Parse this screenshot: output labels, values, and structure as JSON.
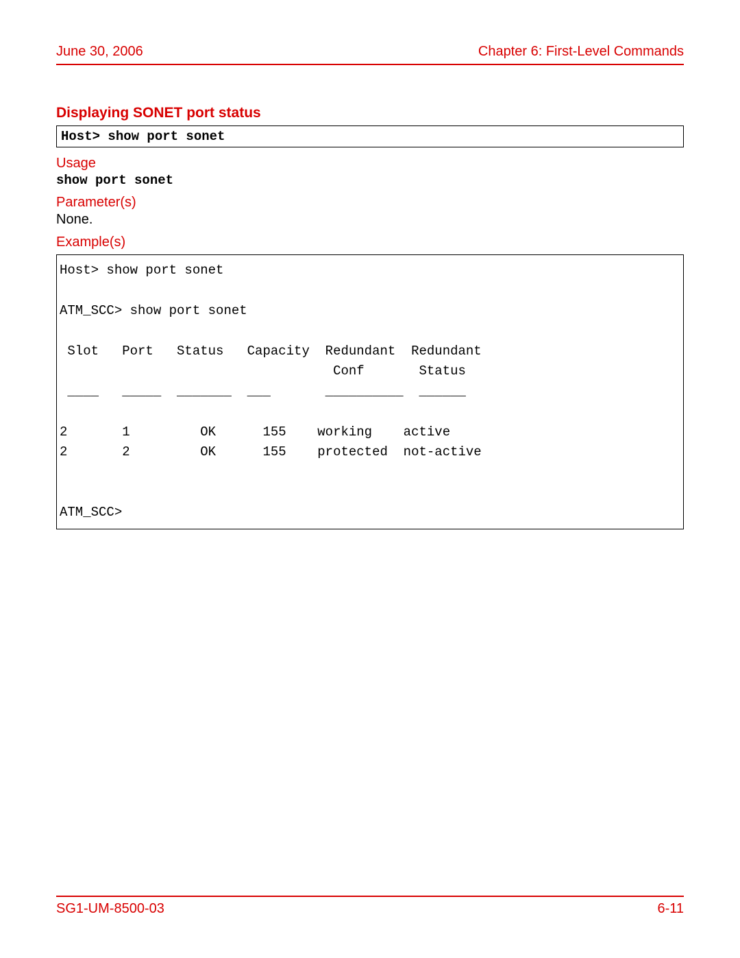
{
  "header": {
    "date": "June 30, 2006",
    "chapter": "Chapter 6: First-Level Commands"
  },
  "section_title": "Displaying SONET port status",
  "command_box": "Host> show port sonet",
  "usage": {
    "label": "Usage",
    "text": "show port sonet"
  },
  "parameters": {
    "label": "Parameter(s)",
    "text": "None."
  },
  "examples": {
    "label": "Example(s)",
    "text": "Host> show port sonet\n\nATM_SCC> show port sonet\n\n Slot   Port   Status   Capacity  Redundant  Redundant\n                                   Conf       Status\n ____   _____  _______  ___       __________  ______\n\n2       1         OK      155    working    active\n2       2         OK      155    protected  not-active\n\n\nATM_SCC>"
  },
  "footer": {
    "doc_id": "SG1-UM-8500-03",
    "page_num": "6-11"
  }
}
